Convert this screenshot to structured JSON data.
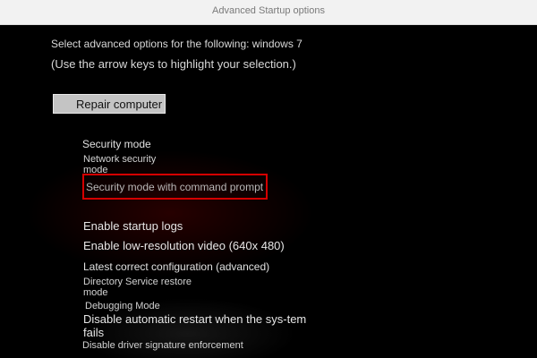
{
  "window": {
    "title": "Advanced Startup options"
  },
  "intro": {
    "line1": "Select advanced options for the following: windows 7",
    "line2": "(Use the arrow keys to highlight your selection.)"
  },
  "repair_button": {
    "label": "Repair computer"
  },
  "options": {
    "security_mode": "Security mode",
    "network_security_mode": "Network security mode",
    "security_mode_command_prompt": "Security mode with command prompt",
    "enable_startup_logs": "Enable startup logs",
    "enable_low_res_video": "Enable low-resolution video (640x 480)",
    "latest_correct_config": "Latest correct configuration (advanced)",
    "directory_service_restore": "Directory Service restore mode",
    "debugging_mode": "Debugging Mode",
    "disable_auto_restart": "Disable automatic restart when the sys-tem fails",
    "disable_driver_signature": "Disable driver signature enforcement"
  },
  "colors": {
    "background": "#000000",
    "text": "#e6e6e6",
    "highlight_border": "#d40000",
    "button_fill": "#c4c4c4",
    "title_bar": "#f2f2f2"
  }
}
